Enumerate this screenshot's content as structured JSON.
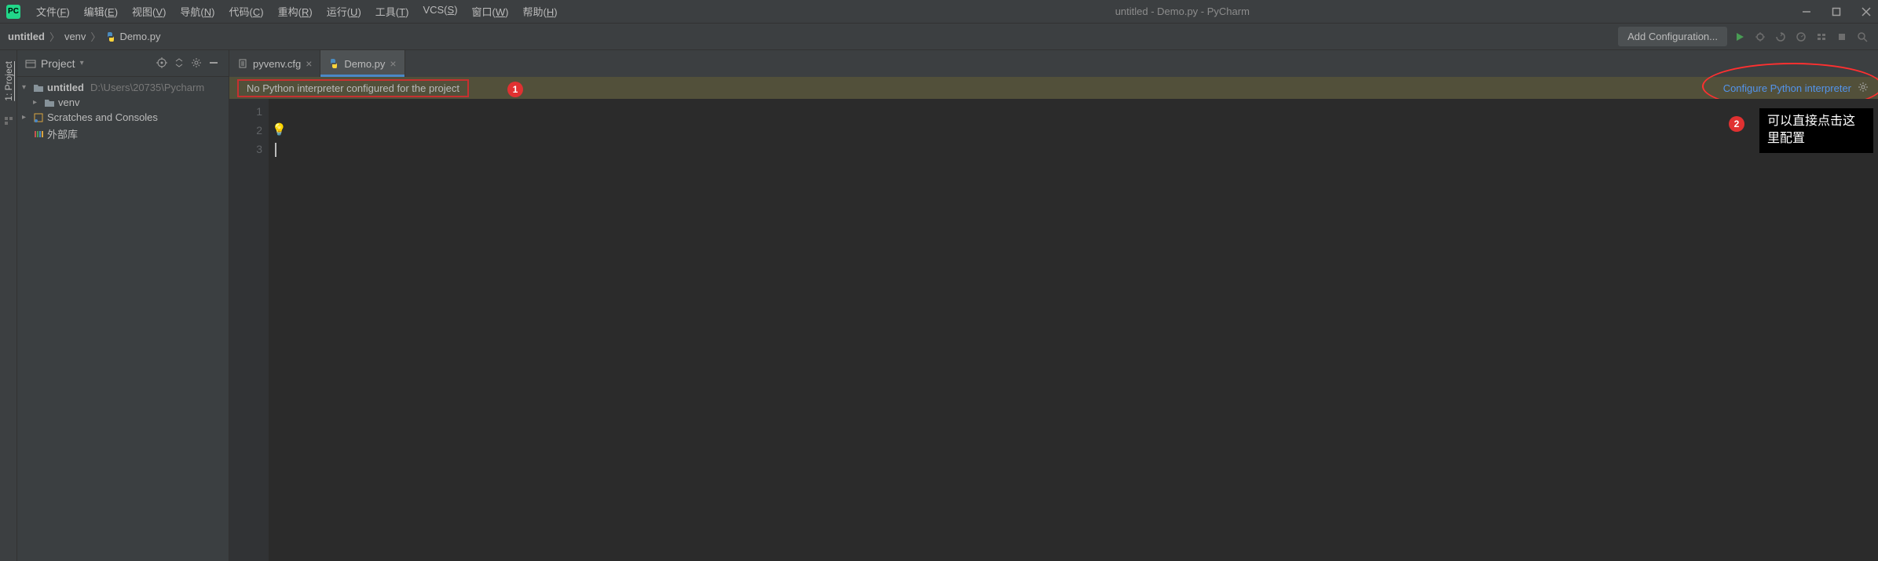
{
  "app_icon_text": "PC",
  "menu": [
    {
      "label": "文件",
      "key": "F"
    },
    {
      "label": "编辑",
      "key": "E"
    },
    {
      "label": "视图",
      "key": "V"
    },
    {
      "label": "导航",
      "key": "N"
    },
    {
      "label": "代码",
      "key": "C"
    },
    {
      "label": "重构",
      "key": "R"
    },
    {
      "label": "运行",
      "key": "U"
    },
    {
      "label": "工具",
      "key": "T"
    },
    {
      "label": "VCS",
      "key": "S"
    },
    {
      "label": "窗口",
      "key": "W"
    },
    {
      "label": "帮助",
      "key": "H"
    }
  ],
  "window_title": "untitled - Demo.py - PyCharm",
  "breadcrumb": {
    "root": "untitled",
    "mid": "venv",
    "file": "Demo.py"
  },
  "add_config_label": "Add Configuration...",
  "left_tab": "1: Project",
  "panel": {
    "title": "Project",
    "tree": {
      "root_name": "untitled",
      "root_path": "D:\\Users\\20735\\Pycharm",
      "venv": "venv",
      "scratches": "Scratches and Consoles",
      "external": "外部库"
    }
  },
  "tabs": [
    {
      "name": "pyvenv.cfg",
      "active": false,
      "icon": "list"
    },
    {
      "name": "Demo.py",
      "active": true,
      "icon": "python"
    }
  ],
  "banner": {
    "message": "No Python interpreter configured for the project",
    "link": "Configure Python interpreter"
  },
  "gutter_lines": [
    "1",
    "2",
    "3"
  ],
  "annotations": {
    "badge1": "1",
    "badge2": "2",
    "tooltip": "可以直接点击这里配置"
  }
}
